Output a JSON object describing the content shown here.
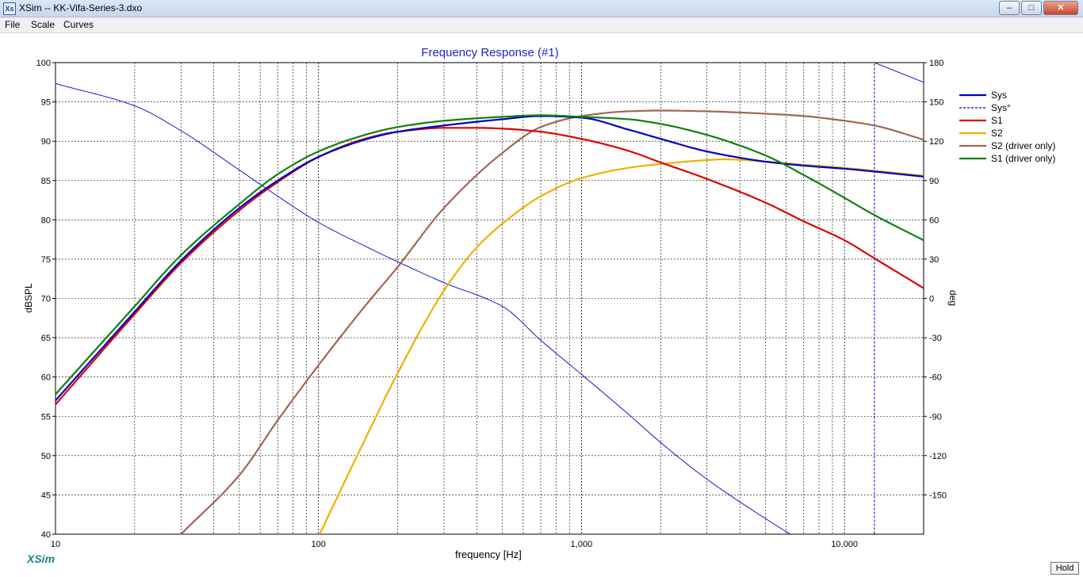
{
  "window": {
    "title": "XSim -- KK-Vifa-Series-3.dxo",
    "icon": "xsim-app-icon",
    "buttons": {
      "minimize": "–",
      "maximize": "□",
      "close": "✕"
    }
  },
  "menu": [
    "File",
    "Scale",
    "Curves"
  ],
  "brand": "XSim",
  "hold_label": "Hold",
  "chart_data": {
    "type": "line",
    "title": "Frequency Response (#1)",
    "xlabel": "frequency [Hz]",
    "ylabel": "dBSPL",
    "y2label": "deg",
    "xscale": "log",
    "xlim": [
      10,
      20000
    ],
    "ylim": [
      40,
      100
    ],
    "y2lim": [
      -180,
      180
    ],
    "grid": true,
    "legend": "right",
    "xtick_labels": [
      {
        "v": 10,
        "t": "10"
      },
      {
        "v": 100,
        "t": "100"
      },
      {
        "v": 1000,
        "t": "1,000"
      },
      {
        "v": 10000,
        "t": "10,000"
      }
    ],
    "yticks": [
      40,
      45,
      50,
      55,
      60,
      65,
      70,
      75,
      80,
      85,
      90,
      95,
      100
    ],
    "y2ticks": [
      -150,
      -120,
      -90,
      -60,
      -30,
      0,
      30,
      60,
      90,
      120,
      150,
      180
    ],
    "series": [
      {
        "name": "Sys",
        "color": "#0000c0",
        "axis": "left",
        "x": [
          10,
          20,
          30,
          50,
          70,
          100,
          150,
          200,
          300,
          500,
          700,
          1000,
          1500,
          2000,
          3000,
          5000,
          7000,
          10000,
          20000
        ],
        "y": [
          57,
          68.3,
          74.8,
          81.5,
          85,
          88,
          90.2,
          91.2,
          92,
          92.8,
          93.2,
          93,
          91.5,
          90.3,
          88.7,
          87.4,
          86.9,
          86.5,
          85.5
        ]
      },
      {
        "name": "Sys°",
        "color": "#0000c0",
        "axis": "right",
        "dashed": true,
        "thin": true,
        "x": [
          10,
          20,
          30,
          50,
          70,
          100,
          150,
          200,
          300,
          500,
          700,
          1000,
          1500,
          2000,
          3000,
          5000,
          7000,
          10000,
          13000,
          13000,
          15000,
          20000
        ],
        "y": [
          164,
          147,
          128,
          98,
          78,
          58,
          40,
          28,
          12,
          -6,
          -32,
          -58,
          -88,
          -110,
          -138,
          -168,
          -186,
          -202,
          -213,
          180,
          175,
          165
        ]
      },
      {
        "name": "S1",
        "color": "#e00000",
        "axis": "left",
        "x": [
          10,
          20,
          30,
          50,
          70,
          100,
          150,
          200,
          300,
          400,
          500,
          700,
          1000,
          1500,
          2000,
          3000,
          5000,
          7000,
          10000,
          13000,
          20000
        ],
        "y": [
          56.5,
          68,
          74.5,
          81.2,
          84.8,
          88,
          90.3,
          91.2,
          91.7,
          91.7,
          91.6,
          91.2,
          90.3,
          88.8,
          87.3,
          85.2,
          82.2,
          79.8,
          77.4,
          75.1,
          71.3
        ]
      },
      {
        "name": "S2",
        "color": "#f0b000",
        "axis": "left",
        "x": [
          100,
          150,
          200,
          300,
          400,
          500,
          700,
          1000,
          1500,
          2000,
          3000,
          3500,
          5000,
          7000,
          10000,
          20000
        ],
        "y": [
          39.7,
          52,
          60.5,
          71,
          76.5,
          79.5,
          83,
          85.3,
          86.6,
          87.1,
          87.6,
          87.7,
          87.4,
          87,
          86.6,
          85.6
        ]
      },
      {
        "name": "S2 (driver only)",
        "color": "#a06850",
        "axis": "left",
        "x": [
          30,
          50,
          70,
          100,
          150,
          200,
          300,
          500,
          700,
          1000,
          1500,
          2000,
          3000,
          5000,
          7000,
          10000,
          13000,
          20000
        ],
        "y": [
          40,
          47.5,
          54.5,
          61.5,
          69,
          74,
          81.5,
          88.5,
          91.8,
          93.2,
          93.8,
          93.9,
          93.8,
          93.5,
          93.2,
          92.6,
          92,
          90.2
        ]
      },
      {
        "name": "S1 (driver only)",
        "color": "#108010",
        "axis": "left",
        "x": [
          10,
          20,
          30,
          50,
          70,
          100,
          150,
          200,
          300,
          500,
          700,
          1000,
          1500,
          2000,
          3000,
          5000,
          7000,
          10000,
          13000,
          20000
        ],
        "y": [
          57.8,
          69,
          75.5,
          82,
          85.8,
          88.7,
          90.8,
          91.8,
          92.6,
          93.1,
          93.3,
          93.1,
          92.8,
          92.2,
          90.8,
          88.2,
          85.7,
          82.8,
          80.6,
          77.4
        ]
      }
    ]
  }
}
